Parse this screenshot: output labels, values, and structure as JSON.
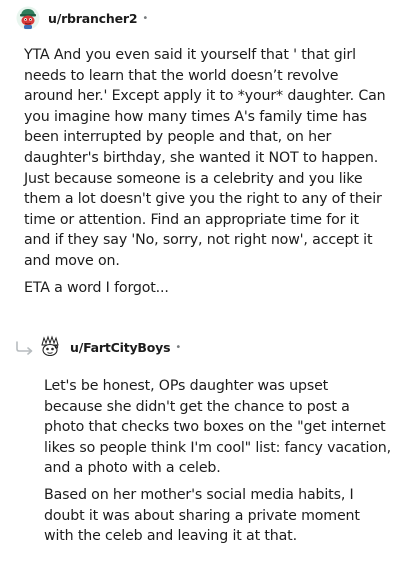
{
  "comments": [
    {
      "username": "u/rbrancher2",
      "separator": "•",
      "avatar_icon": "snoo-avatar-red-icon",
      "paragraphs": [
        [
          "YTA And you even said it yourself that ' that girl",
          "needs to learn that the world doesn’t revolve",
          "around her.' Except apply it to *your* daughter. Can",
          "you imagine how many times A's family time has",
          "been interrupted by people and that, on her",
          "daughter's birthday, she wanted it NOT to happen.",
          "Just because someone is a celebrity and you like",
          "them a lot doesn't give you the right to any of their",
          "time or attention. Find an appropriate time for it",
          "and if they say 'No, sorry, not right now', accept it",
          "and move on."
        ],
        [
          "ETA a word I forgot..."
        ]
      ]
    },
    {
      "username": "u/FartCityBoys",
      "separator": "•",
      "avatar_icon": "snoo-avatar-white-icon",
      "reply_icon": "reply-arrow-icon",
      "paragraphs": [
        [
          "Let's be honest, OPs daughter was upset",
          "because she didn't get the chance to post a",
          "photo that checks two boxes on the \"get internet",
          "likes so people think I'm cool\" list: fancy vacation,",
          "and a photo with a celeb."
        ],
        [
          "Based on her mother's social media habits, I",
          "doubt it was about sharing a private moment",
          "with the celeb and leaving it at that."
        ]
      ]
    }
  ],
  "colors": {
    "text": "#1c1c1c",
    "meta": "#787c7e",
    "avatar1_bg": "#e8f5ee",
    "avatar1_accent": "#d93a3a",
    "avatar2_accent": "#222222"
  }
}
